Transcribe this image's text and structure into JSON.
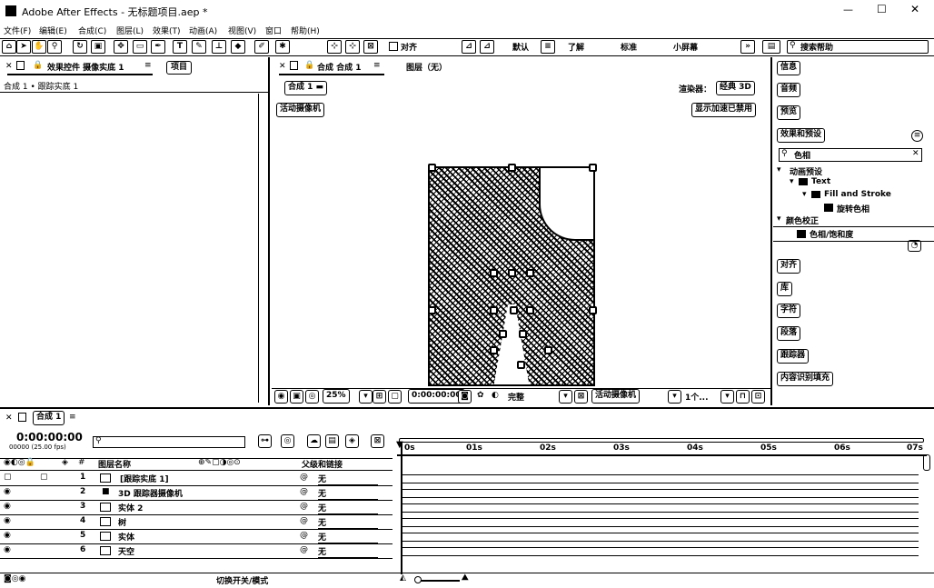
{
  "window": {
    "title": "Adobe After Effects - 无标题项目.aep *",
    "minimize": "—",
    "maximize": "☐",
    "close": "✕"
  },
  "menu": [
    "文件(F)",
    "编辑(E)",
    "合成(C)",
    "图层(L)",
    "效果(T)",
    "动画(A)",
    "视图(V)",
    "窗口",
    "帮助(H)"
  ],
  "toolbar": {
    "snap_label": "对齐",
    "workspaces": [
      "默认",
      "了解",
      "标准",
      "小屏幕"
    ],
    "search_placeholder": "搜索帮助"
  },
  "left_panel": {
    "tab_effects": "效果控件 摄像实底 1",
    "tab_project": "项目",
    "breadcrumb": "合成 1 • 跟踪实底 1"
  },
  "comp_panel": {
    "tab_comp": "合成 合成 1",
    "layer_label": "图层（无）",
    "comp_chip": "合成 1",
    "renderer_label": "渲染器：",
    "renderer_value": "经典 3D",
    "active_camera": "活动摄像机",
    "accel_disabled": "显示加速已禁用",
    "footer": {
      "zoom": "25%",
      "timecode": "0:00:00:00",
      "quality": "完整",
      "camera": "活动摄像机",
      "views": "1个..."
    }
  },
  "right_panel": {
    "items_top": [
      "信息",
      "音频",
      "预览",
      "效果和预设"
    ],
    "search_value": "色相",
    "tree": [
      "动画预设",
      "Text",
      "Fill and Stroke",
      "旋转色相",
      "颜色校正",
      "色相/饱和度"
    ],
    "items_bottom": [
      "对齐",
      "库",
      "字符",
      "段落",
      "跟踪器",
      "内容识别填充"
    ]
  },
  "timeline": {
    "tab": "合成 1",
    "timecode": "0:00:00:00",
    "fps": "00000 (25.00 fps)",
    "col_source": "图层名称",
    "col_parent": "父级和链接",
    "ruler": [
      "0s",
      "01s",
      "02s",
      "03s",
      "04s",
      "05s",
      "06s",
      "07s"
    ],
    "layers": [
      {
        "num": "1",
        "name": "[跟踪实底 1]",
        "parent": "无"
      },
      {
        "num": "2",
        "name": "3D 跟踪器摄像机",
        "parent": "无"
      },
      {
        "num": "3",
        "name": "实体 2",
        "parent": "无"
      },
      {
        "num": "4",
        "name": "树",
        "parent": "无"
      },
      {
        "num": "5",
        "name": "实体",
        "parent": "无"
      },
      {
        "num": "6",
        "name": "天空",
        "parent": "无"
      }
    ],
    "switch_modes": "切换开关/模式"
  }
}
